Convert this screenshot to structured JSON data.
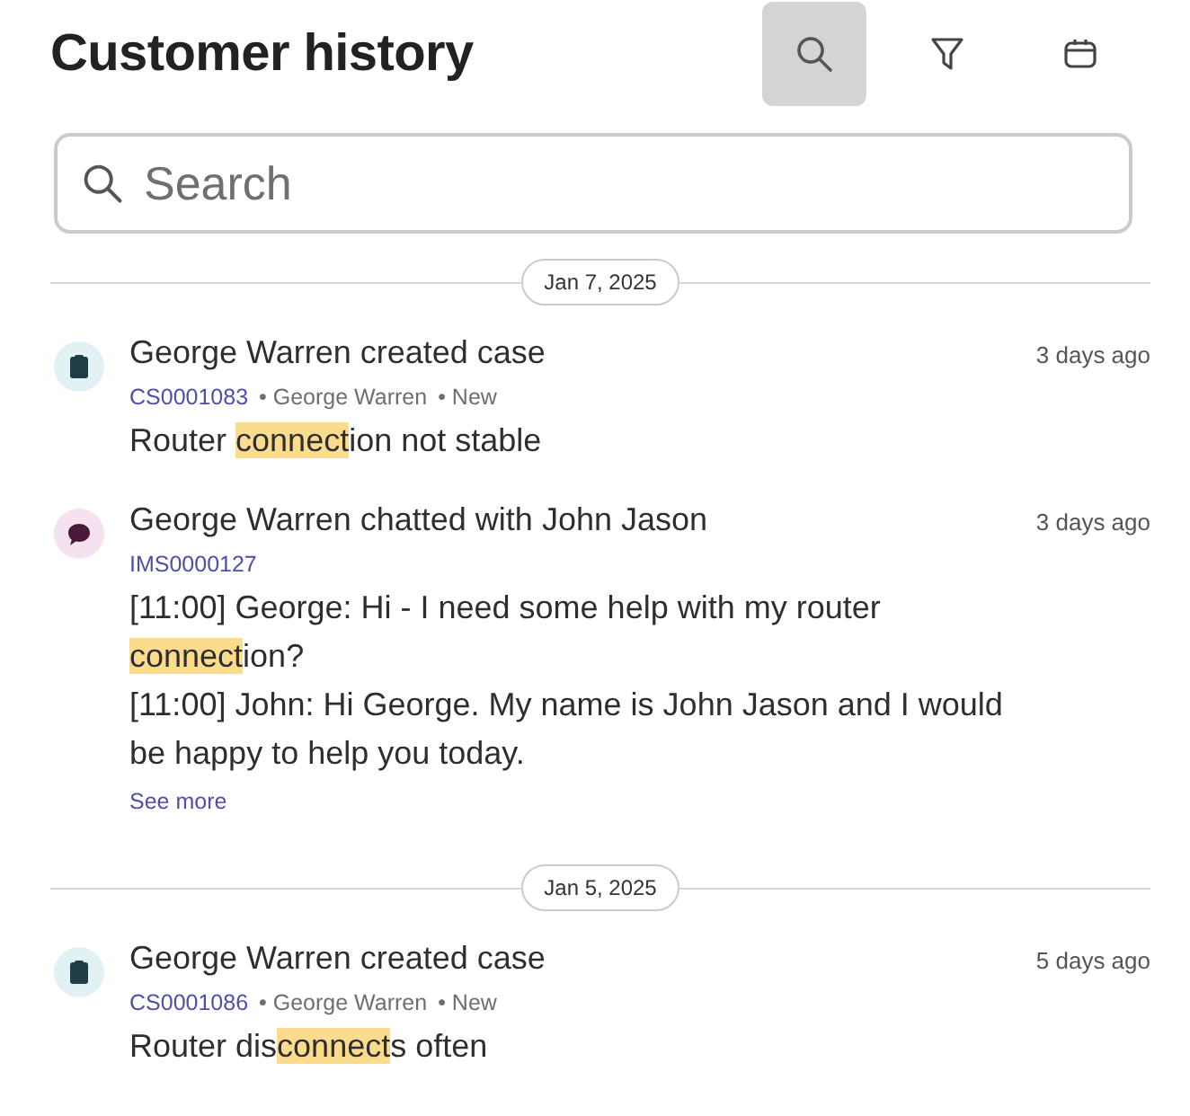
{
  "header": {
    "title": "Customer history",
    "tools": [
      {
        "kind": "search",
        "selected": true
      },
      {
        "kind": "filter",
        "selected": false
      },
      {
        "kind": "calendar",
        "selected": false
      }
    ]
  },
  "search": {
    "placeholder": "Search"
  },
  "groups": [
    {
      "date": "Jan 7, 2025",
      "entries": [
        {
          "kind": "case",
          "title": "George Warren created case",
          "time": "3 days ago",
          "id": "CS0001083",
          "details": [
            "• George Warren",
            "• New"
          ],
          "body": [
            [
              {
                "text": "Router ",
                "highlighted": false
              },
              {
                "text": "connect",
                "highlighted": true
              },
              {
                "text": "ion not stable",
                "highlighted": false
              }
            ]
          ]
        },
        {
          "kind": "chat",
          "title": "George Warren chatted with John Jason",
          "time": "3 days ago",
          "id": "IMS0000127",
          "body": [
            [
              {
                "text": "[11:00] George: Hi - I need some help with my router ",
                "highlighted": false
              },
              {
                "text": "connect",
                "highlighted": true
              },
              {
                "text": "ion?",
                "highlighted": false
              }
            ],
            [
              {
                "text": "[11:00] John: Hi George. My name is John Jason and I would be happy to help you today.",
                "highlighted": false
              }
            ]
          ],
          "more": "See more"
        }
      ]
    },
    {
      "date": "Jan 5, 2025",
      "entries": [
        {
          "kind": "case",
          "title": "George Warren created case",
          "time": "5 days ago",
          "id": "CS0001086",
          "details": [
            "• George Warren",
            "• New"
          ],
          "body": [
            [
              {
                "text": "Router dis",
                "highlighted": false
              },
              {
                "text": "connect",
                "highlighted": true
              },
              {
                "text": "s often",
                "highlighted": false
              }
            ]
          ]
        }
      ]
    }
  ]
}
